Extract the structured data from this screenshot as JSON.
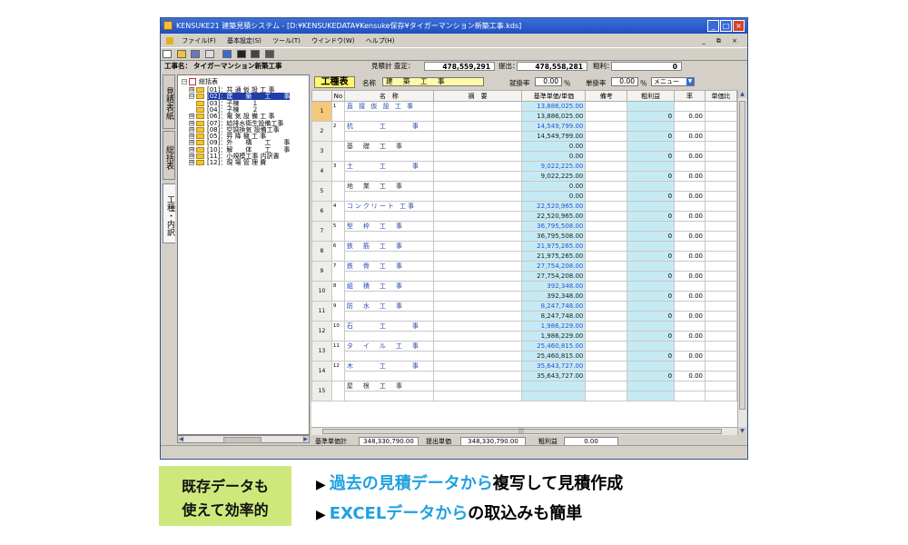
{
  "window": {
    "title": "KENSUKE21  建築見積システム - [D:¥KENSUKEDATA¥Kensuke保存¥タイガーマンション新築工事.kds]",
    "controls": [
      "_",
      "□",
      "×"
    ]
  },
  "menu": {
    "items": [
      "ファイル(F)",
      "基本設定(S)",
      "ツール(T)",
      "ウインドウ(W)",
      "ヘルプ(H)"
    ],
    "mdi_controls": "_ ⧉ ×"
  },
  "info": {
    "project_label": "工事名：",
    "project_name": "タイガーマンション新築工事",
    "estimate_label": "見積計 査定：",
    "estimate_value": "478,559,291",
    "submit_label": "提出：",
    "submit_value": "478,558,281",
    "profit_label": "粗利：",
    "profit_value": "0"
  },
  "side_tabs": [
    "見積表紙",
    "総括表",
    "工種・内訳"
  ],
  "tree": {
    "root": "総括表",
    "items": [
      {
        "code": "[01]：",
        "name": "共 通 仮 設 工 事",
        "expand": "⊞",
        "selected": false
      },
      {
        "code": "[02]：",
        "name": "建　　築　　工　　事",
        "expand": "⊟",
        "selected": true
      },
      {
        "code": "[03]：",
        "name": "子棟　　１",
        "expand": "",
        "selected": false
      },
      {
        "code": "[04]：",
        "name": "子棟　　２",
        "expand": "",
        "selected": false
      },
      {
        "code": "[06]：",
        "name": "電 気 設 備 工 事",
        "expand": "⊞",
        "selected": false
      },
      {
        "code": "[07]：",
        "name": "給排水衛生設備工事",
        "expand": "⊞",
        "selected": false
      },
      {
        "code": "[08]：",
        "name": "空調換気 設備工事",
        "expand": "⊞",
        "selected": false
      },
      {
        "code": "[05]：",
        "name": "昇 降 機 工 事",
        "expand": "⊞",
        "selected": false
      },
      {
        "code": "[09]：",
        "name": "外　　構　　工　　事",
        "expand": "⊞",
        "selected": false
      },
      {
        "code": "[10]：",
        "name": "解　　体　　工　　事",
        "expand": "⊞",
        "selected": false
      },
      {
        "code": "[11]：",
        "name": "小規模工事 内訳書",
        "expand": "⊞",
        "selected": false
      },
      {
        "code": "[12]：",
        "name": "現 場 管 理 費",
        "expand": "⊞",
        "selected": false
      }
    ]
  },
  "panel": {
    "badge": "工種表",
    "name_label": "名称",
    "name_value": "建　築　工　事",
    "discount_label": "就掛率",
    "discount_value": "0.00",
    "discount_unit": "％",
    "unit_rate_label": "単掛率",
    "unit_rate_value": "0.00",
    "unit_rate_unit": "％",
    "menu_label": "メニュー"
  },
  "grid": {
    "columns": [
      "No",
      "名　称",
      "摘　要",
      "基準単価/単価",
      "備考",
      "粗利益",
      "率",
      "単価比"
    ],
    "rows": [
      {
        "no": "1",
        "sub": "1",
        "name": "直 接 仮 設 工 事",
        "amt1": "13,886,025.00",
        "amt2": "13,886,025.00",
        "profit": "0",
        "rate": "0.00",
        "current": true,
        "blue": true
      },
      {
        "no": "2",
        "sub": "2",
        "name": "杭　　　工　　　事",
        "amt1": "14,549,799.00",
        "amt2": "14,549,799.00",
        "profit": "0",
        "rate": "0.00",
        "current": false,
        "blue": true
      },
      {
        "no": "3",
        "sub": "",
        "name": "基　礎　工　事",
        "amt1": "0.00",
        "amt2": "0.00",
        "profit": "0",
        "rate": "0.00",
        "current": false,
        "blue": false
      },
      {
        "no": "4",
        "sub": "3",
        "name": "土　　　工　　　事",
        "amt1": "9,022,225.00",
        "amt2": "9,022,225.00",
        "profit": "0",
        "rate": "0.00",
        "current": false,
        "blue": true
      },
      {
        "no": "5",
        "sub": "",
        "name": "地　業　工　事",
        "amt1": "0.00",
        "amt2": "0.00",
        "profit": "0",
        "rate": "0.00",
        "current": false,
        "blue": false
      },
      {
        "no": "6",
        "sub": "4",
        "name": "コンクリート 工事",
        "amt1": "22,520,965.00",
        "amt2": "22,520,965.00",
        "profit": "0",
        "rate": "0.00",
        "current": false,
        "blue": true
      },
      {
        "no": "7",
        "sub": "5",
        "name": "型　枠　工　事",
        "amt1": "36,795,508.00",
        "amt2": "36,795,508.00",
        "profit": "0",
        "rate": "0.00",
        "current": false,
        "blue": true
      },
      {
        "no": "8",
        "sub": "6",
        "name": "鉄　筋　工　事",
        "amt1": "21,975,265.00",
        "amt2": "21,975,265.00",
        "profit": "0",
        "rate": "0.00",
        "current": false,
        "blue": true
      },
      {
        "no": "9",
        "sub": "7",
        "name": "鉄　骨　工　事",
        "amt1": "27,754,208.00",
        "amt2": "27,754,208.00",
        "profit": "0",
        "rate": "0.00",
        "current": false,
        "blue": true
      },
      {
        "no": "10",
        "sub": "8",
        "name": "組　積　工　事",
        "amt1": "392,348.00",
        "amt2": "392,348.00",
        "profit": "0",
        "rate": "0.00",
        "current": false,
        "blue": true
      },
      {
        "no": "11",
        "sub": "9",
        "name": "防　水　工　事",
        "amt1": "8,247,748.00",
        "amt2": "8,247,748.00",
        "profit": "0",
        "rate": "0.00",
        "current": false,
        "blue": true
      },
      {
        "no": "12",
        "sub": "10",
        "name": "石　　　工　　　事",
        "amt1": "1,986,229.00",
        "amt2": "1,986,229.00",
        "profit": "0",
        "rate": "0.00",
        "current": false,
        "blue": true
      },
      {
        "no": "13",
        "sub": "11",
        "name": "タ　イ　ル　工　事",
        "amt1": "25,460,815.00",
        "amt2": "25,460,815.00",
        "profit": "0",
        "rate": "0.00",
        "current": false,
        "blue": true
      },
      {
        "no": "14",
        "sub": "12",
        "name": "木　　　工　　　事",
        "amt1": "35,643,727.00",
        "amt2": "35,643,727.00",
        "profit": "0",
        "rate": "0.00",
        "current": false,
        "blue": true
      },
      {
        "no": "15",
        "sub": "",
        "name": "屋　根　工　事",
        "amt1": "",
        "amt2": "",
        "profit": "",
        "rate": "",
        "current": false,
        "blue": false
      }
    ]
  },
  "footer": {
    "base_total_label": "基準単価計",
    "base_total_value": "348,330,790.00",
    "submit_total_label": "提出単価",
    "submit_total_value": "348,330,790.00",
    "profit_label": "粗利益",
    "profit_value": "0.00"
  },
  "promo": {
    "box_line1": "既存データも",
    "box_line2": "使えて効率的",
    "bullet_marker": "▶",
    "line1_highlight": "過去の見積データから",
    "line1_rest": "複写して見積作成",
    "line2_highlight": "EXCELデータから",
    "line2_rest": "の取込みも簡単"
  },
  "colors": {
    "titlebar": "#1f4fbf",
    "amount_cell": "#c5eaf4",
    "amount_text": "#3050d0",
    "badge": "#fff66a",
    "promo_box": "#cfe87c",
    "promo_highlight": "#1fa1e0"
  },
  "icons": [
    "app-icon",
    "new-icon",
    "open-icon",
    "save-icon",
    "print-icon",
    "folder-icon",
    "tree-root-icon"
  ]
}
